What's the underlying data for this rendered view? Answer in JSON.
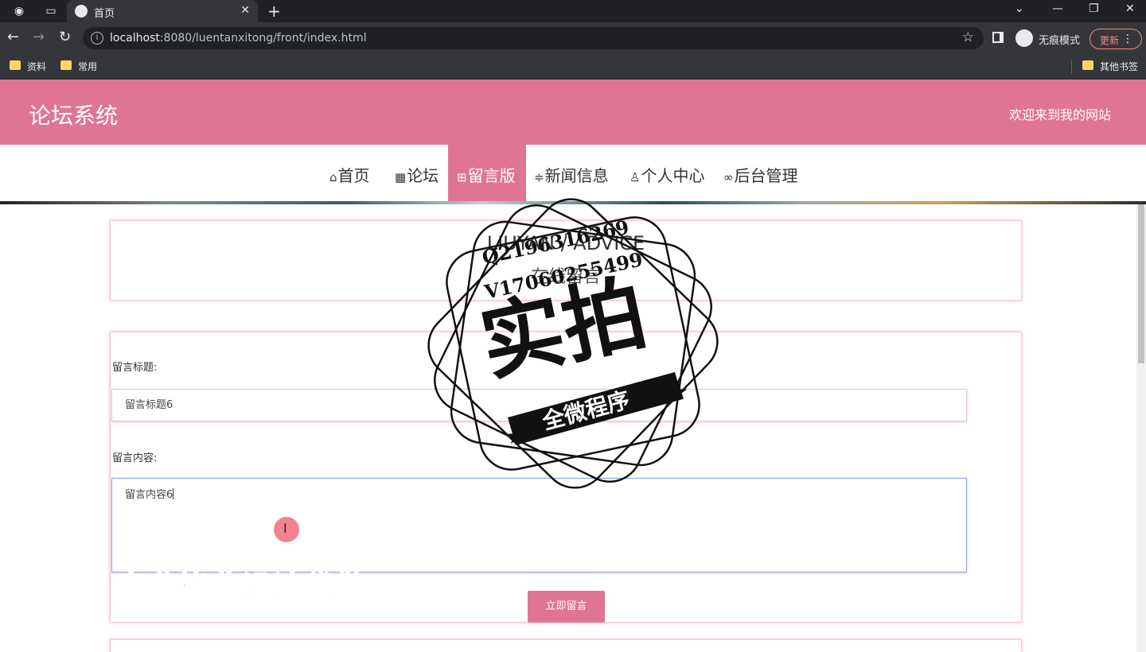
{
  "browser": {
    "tab_title": "首页",
    "url_host": "localhost",
    "url_rest": ":8080/luentanxitong/front/index.html",
    "incognito_label": "无痕模式",
    "update_label": "更新",
    "bookmarks": [
      "资料",
      "常用"
    ],
    "other_bookmarks": "其他书签"
  },
  "site": {
    "title": "论坛系统",
    "welcome": "欢迎来到我的网站",
    "nav": [
      {
        "label": "首页",
        "icon": "home-icon"
      },
      {
        "label": "论坛",
        "icon": "grid-icon"
      },
      {
        "label": "留言版",
        "icon": "gift-icon",
        "active": true
      },
      {
        "label": "新闻信息",
        "icon": "sliders-icon"
      },
      {
        "label": "个人中心",
        "icon": "user-icon"
      },
      {
        "label": "后台管理",
        "icon": "link-icon"
      }
    ],
    "accent_color": "#e07593"
  },
  "advice": {
    "heading_en": "LIUYAN / ADVICE",
    "heading_cn": "在线留言",
    "form": {
      "title_label": "留言标题:",
      "title_value": "留言标题6",
      "content_label": "留言内容:",
      "content_value": "留言内容6",
      "submit_label": "立即留言"
    }
  },
  "watermark": {
    "contact_q": "Q2196316269",
    "contact_v": "V17060255499",
    "stamp_main": "实拍",
    "stamp_banner": "全微程序",
    "promo_text": "专业毕业设计代做"
  }
}
